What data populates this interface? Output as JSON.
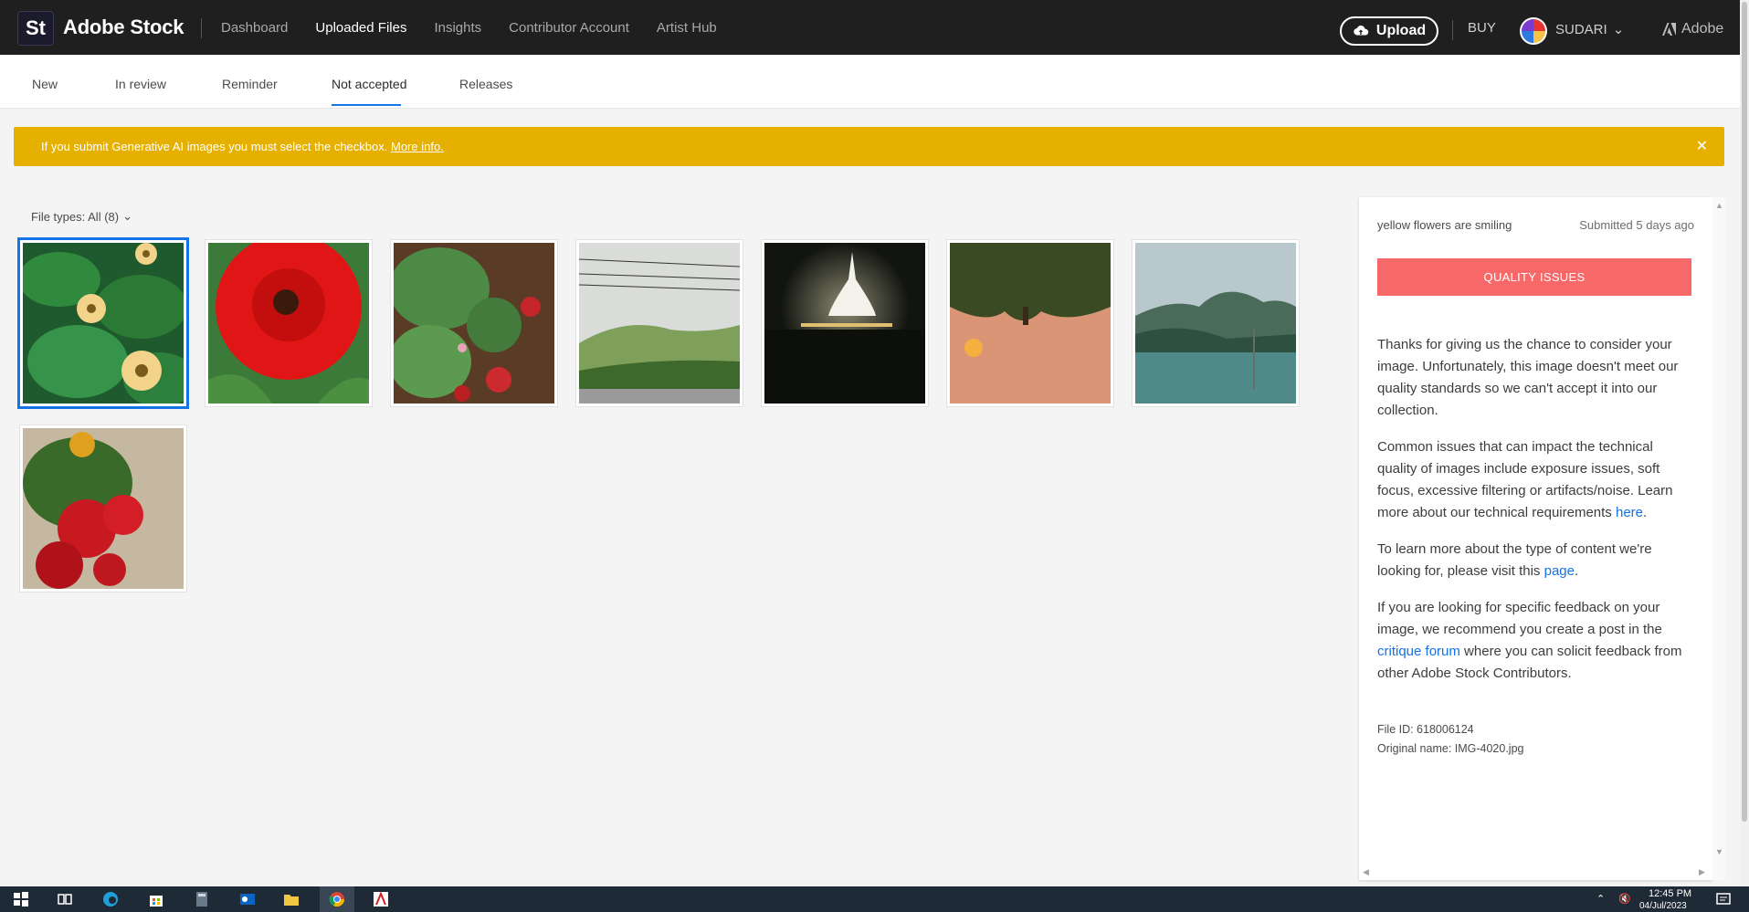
{
  "header": {
    "logo_text": "St",
    "brand": "Adobe Stock",
    "nav": [
      "Dashboard",
      "Uploaded Files",
      "Insights",
      "Contributor Account",
      "Artist Hub"
    ],
    "active_nav": "Uploaded Files",
    "upload_label": "Upload",
    "buy_label": "BUY",
    "user_name": "SUDARI",
    "adobe_label": "Adobe"
  },
  "subtabs": [
    "New",
    "In review",
    "Reminder",
    "Not accepted",
    "Releases"
  ],
  "active_subtab": "Not accepted",
  "banner": {
    "text": "If you submit Generative AI images you must select the checkbox.",
    "link": "More info.",
    "color": "#e6b000"
  },
  "filter": {
    "label": "File types: All (8)"
  },
  "thumbnails": [
    {
      "subject": "yellow flowers with green leaves",
      "selected": true
    },
    {
      "subject": "red gerbera flower"
    },
    {
      "subject": "strawberry plant"
    },
    {
      "subject": "misty tea hills"
    },
    {
      "subject": "illuminated stupa at night"
    },
    {
      "subject": "sunset over trees (inverted)"
    },
    {
      "subject": "mountain lake"
    },
    {
      "subject": "red geranium flowers"
    }
  ],
  "panel": {
    "title": "yellow flowers are smiling",
    "submitted": "Submitted 5 days ago",
    "status_button": "QUALITY ISSUES",
    "status_color": "#f76969",
    "p1": "Thanks for giving us the chance to consider your image. Unfortunately, this image doesn't meet our quality standards so we can't accept it into our collection.",
    "p2_text": "Common issues that can impact the technical quality of images include exposure issues, soft focus, excessive filtering or artifacts/noise. Learn more about our technical requirements",
    "p2_link": "here",
    "p3_text": "To learn more about the type of content we're looking for, please visit this",
    "p3_link": "page",
    "p4_pre": "If you are looking for specific feedback on your image, we recommend you create a post in the",
    "p4_link": "critique forum",
    "p4_post": "where you can solicit feedback from other Adobe Stock Contributors.",
    "file_id": "File ID: 618006124",
    "original_name": "Original name: IMG-4020.jpg"
  },
  "taskbar": {
    "time": "12:45 PM",
    "date": "04/Jul/2023"
  },
  "colors": {
    "topbar": "#1f1f1f",
    "accent": "#1473e6",
    "taskbar": "#1f2a37"
  }
}
